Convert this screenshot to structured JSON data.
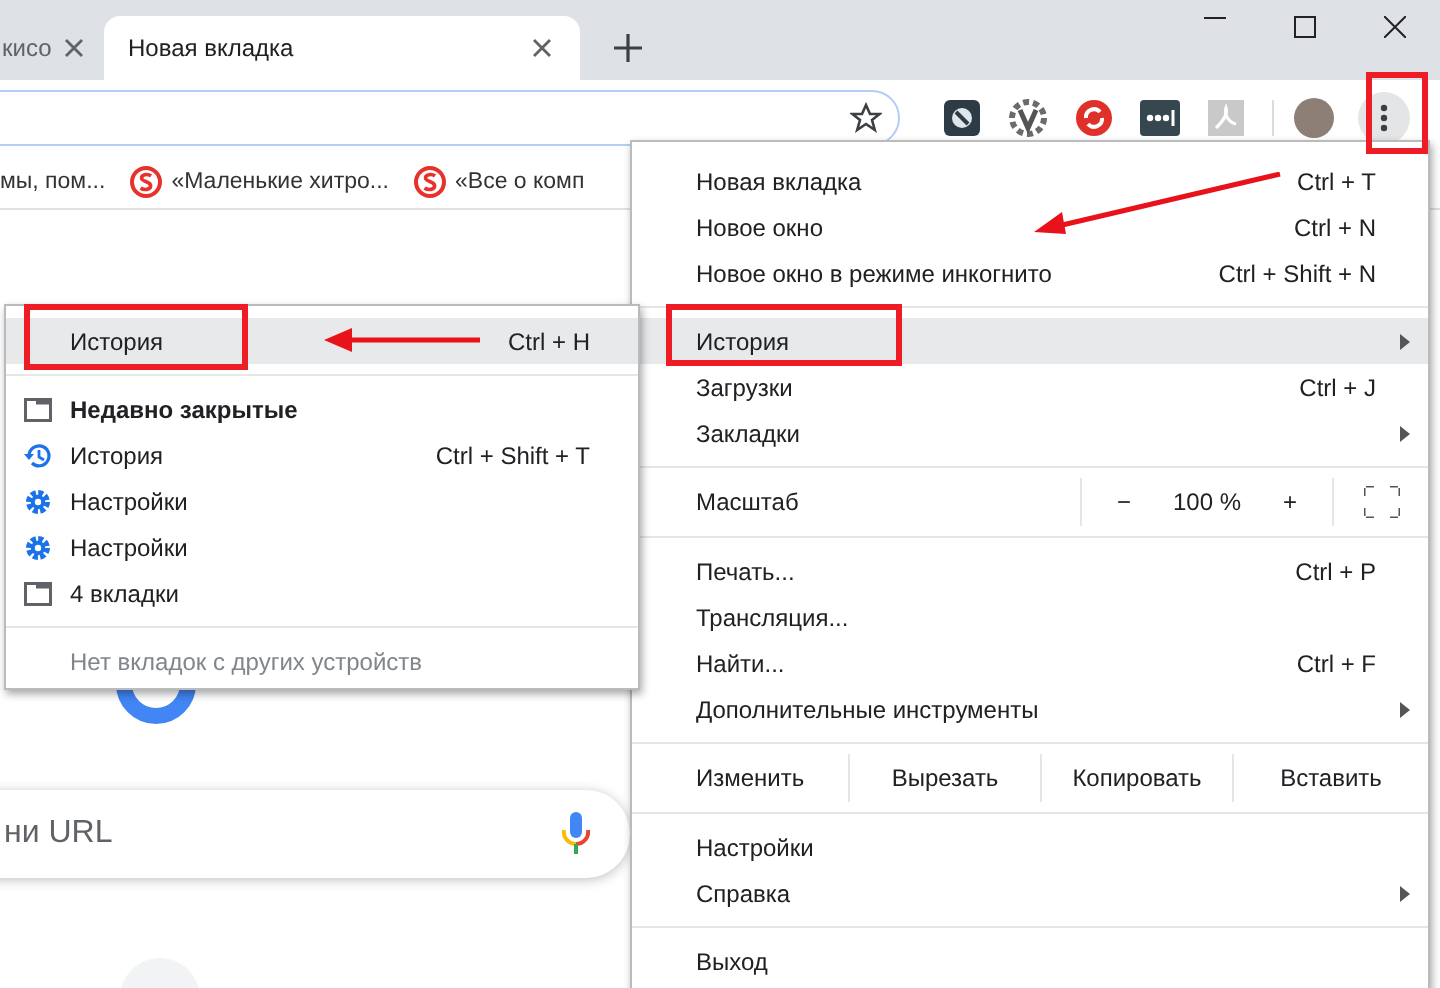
{
  "tabs": [
    {
      "title": "кисо",
      "selected": false
    },
    {
      "title": "Новая вкладка",
      "selected": true
    }
  ],
  "bookmarks": [
    {
      "label": "мы, пом...",
      "icon": false
    },
    {
      "label": "«Маленькие хитро...",
      "icon": true
    },
    {
      "label": "«Все о комп",
      "icon": true
    }
  ],
  "search": {
    "placeholder": "ни URL"
  },
  "main_menu": {
    "sections": [
      [
        {
          "kind": "item",
          "label": "Новая вкладка",
          "shortcut": "Ctrl + T",
          "submenu": false,
          "selected": false
        },
        {
          "kind": "item",
          "label": "Новое окно",
          "shortcut": "Ctrl + N",
          "submenu": false,
          "selected": false
        },
        {
          "kind": "item",
          "label": "Новое окно в режиме инкогнито",
          "shortcut": "Ctrl + Shift + N",
          "submenu": false,
          "selected": false
        }
      ],
      [
        {
          "kind": "item",
          "label": "История",
          "submenu": true,
          "selected": true
        },
        {
          "kind": "item",
          "label": "Загрузки",
          "shortcut": "Ctrl + J",
          "submenu": false,
          "selected": false
        },
        {
          "kind": "item",
          "label": "Закладки",
          "submenu": true,
          "selected": false
        }
      ],
      [
        {
          "kind": "zoom",
          "label": "Масштаб",
          "minus": "−",
          "value": "100 %",
          "plus": "+"
        }
      ],
      [
        {
          "kind": "item",
          "label": "Печать...",
          "shortcut": "Ctrl + P",
          "submenu": false,
          "selected": false
        },
        {
          "kind": "item",
          "label": "Трансляция...",
          "submenu": false,
          "selected": false
        },
        {
          "kind": "item",
          "label": "Найти...",
          "shortcut": "Ctrl + F",
          "submenu": false,
          "selected": false
        },
        {
          "kind": "item",
          "label": "Дополнительные инструменты",
          "submenu": true,
          "selected": false
        }
      ],
      [
        {
          "kind": "edit",
          "label": "Изменить",
          "actions": [
            "Вырезать",
            "Копировать",
            "Вставить"
          ]
        }
      ],
      [
        {
          "kind": "item",
          "label": "Настройки",
          "submenu": false,
          "selected": false
        },
        {
          "kind": "item",
          "label": "Справка",
          "submenu": true,
          "selected": false
        }
      ],
      [
        {
          "kind": "item",
          "label": "Выход",
          "submenu": false,
          "selected": false
        }
      ]
    ]
  },
  "history_menu": {
    "header": {
      "label": "История",
      "shortcut": "Ctrl + H",
      "selected": true
    },
    "title": "Недавно закрытые",
    "items": [
      {
        "kind": "history",
        "label": "История",
        "shortcut": "Ctrl + Shift + T",
        "selected": false
      },
      {
        "kind": "settings",
        "label": "Настройки",
        "selected": false
      },
      {
        "kind": "settings",
        "label": "Настройки",
        "selected": false
      },
      {
        "kind": "tab",
        "label": "4 вкладки",
        "selected": false
      }
    ],
    "note": "Нет вкладок с других устройств"
  }
}
